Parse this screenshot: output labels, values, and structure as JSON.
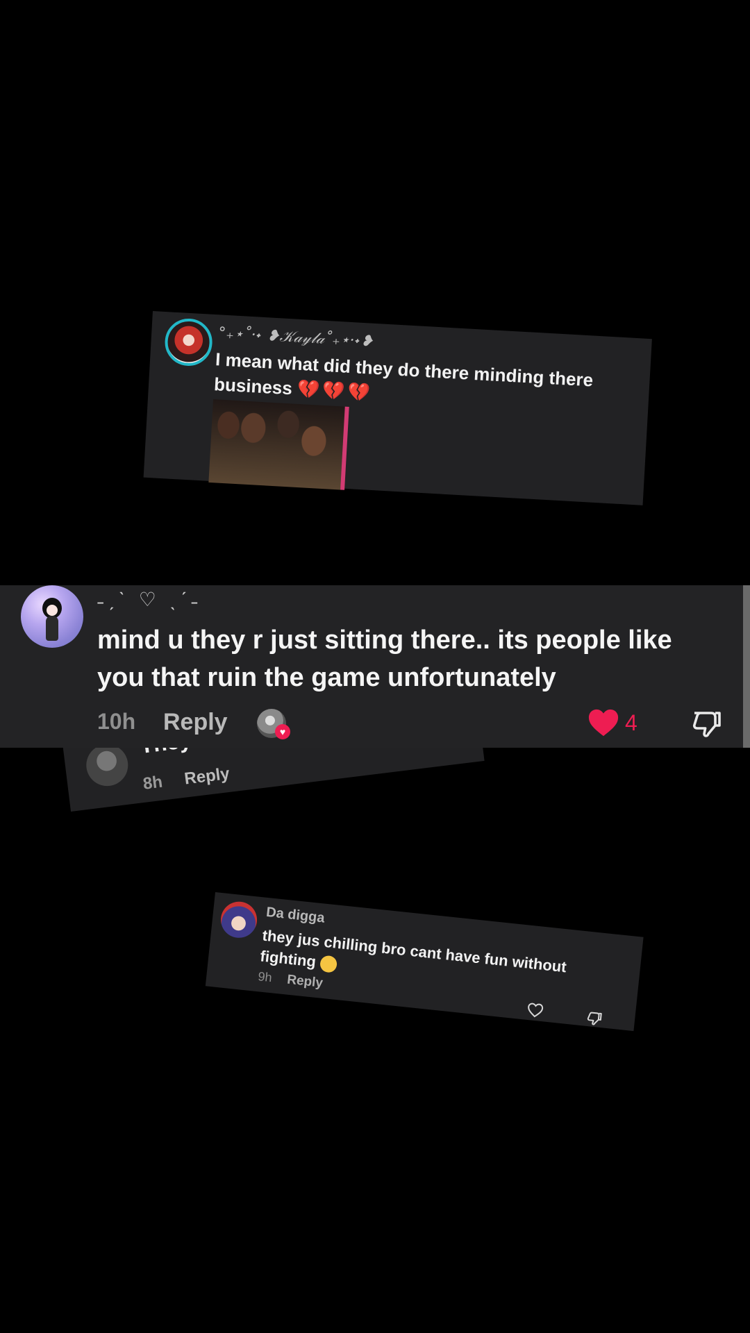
{
  "card1": {
    "username": "°₊⋆˚·˖ ❥𝒦𝒶𝓎𝓁𝒶˚₊⋆·˖❥",
    "comment": "I mean what did they do there minding there business",
    "emoji": "💔💔💔"
  },
  "card3": {
    "partial_text": "They",
    "time": "8h",
    "reply": "Reply"
  },
  "main": {
    "username": "˗ˏˋ ♡ ˎˊ˗",
    "comment": "mind u they r just sitting there.. its people like you that ruin the game unfortunately",
    "time": "10h",
    "reply": "Reply",
    "like_count": "4",
    "accent": "#ee1d52"
  },
  "card4": {
    "username": "Da digga",
    "comment": "they jus chilling bro cant have fun without fighting",
    "time": "9h",
    "reply": "Reply"
  }
}
